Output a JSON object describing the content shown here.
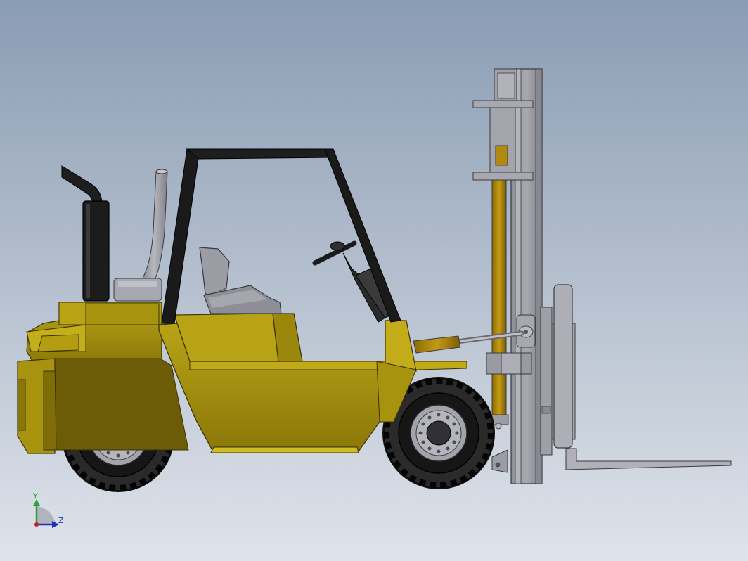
{
  "viewport": {
    "background_top": "#8a9cb3",
    "background_bottom": "#dfe3ea"
  },
  "triad": {
    "y_label": "Y",
    "z_label": "Z",
    "y_color": "#2fa33a",
    "z_color": "#1f2fbf",
    "x_color": "#c81e1e"
  },
  "model": {
    "body_color": "#9c870d",
    "body_light": "#b9a416",
    "body_dark": "#6f5f08",
    "mast_color": "#9a9ba3",
    "mast_dark": "#6e6f77",
    "tire_color": "#141414",
    "rim_color": "#a9aab0",
    "exhaust_color": "#1c1c1c",
    "cylinder_color": "#b08a10"
  }
}
